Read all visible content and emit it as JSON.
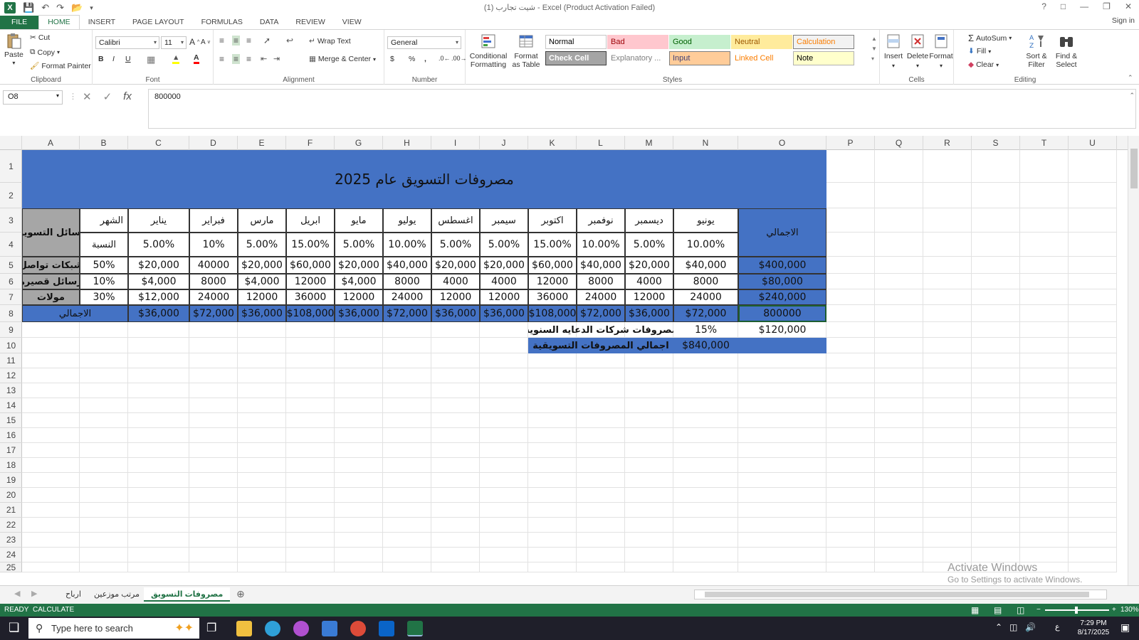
{
  "window": {
    "title": "شيت تجارب (1) - Excel (Product Activation Failed)",
    "sign_in": "Sign in"
  },
  "tabs": [
    "FILE",
    "HOME",
    "INSERT",
    "PAGE LAYOUT",
    "FORMULAS",
    "DATA",
    "REVIEW",
    "VIEW"
  ],
  "ribbon": {
    "clipboard": {
      "paste": "Paste",
      "cut": "Cut",
      "copy": "Copy",
      "format_painter": "Format Painter",
      "label": "Clipboard"
    },
    "font": {
      "name": "Calibri",
      "size": "11",
      "bold": "B",
      "italic": "I",
      "underline": "U",
      "label": "Font"
    },
    "alignment": {
      "wrap": "Wrap Text",
      "merge": "Merge & Center",
      "label": "Alignment"
    },
    "number": {
      "format": "General",
      "currency": "$",
      "percent": "%",
      "comma": ",",
      "label": "Number"
    },
    "styles": {
      "conditional": "Conditional Formatting",
      "format_table": "Format as Table",
      "cells": [
        {
          "name": "Normal",
          "bg": "#ffffff",
          "fg": "#000000",
          "border": "#c6c6c6"
        },
        {
          "name": "Bad",
          "bg": "#ffc7ce",
          "fg": "#9c0006",
          "border": "#ffc7ce"
        },
        {
          "name": "Good",
          "bg": "#c6efce",
          "fg": "#006100",
          "border": "#c6efce"
        },
        {
          "name": "Neutral",
          "bg": "#ffeb9c",
          "fg": "#9c5700",
          "border": "#ffeb9c"
        },
        {
          "name": "Calculation",
          "bg": "#f2f2f2",
          "fg": "#fa7d00",
          "border": "#7f7f7f"
        },
        {
          "name": "Check Cell",
          "bg": "#a5a5a5",
          "fg": "#ffffff",
          "border": "#3f3f3f"
        },
        {
          "name": "Explanatory ...",
          "bg": "#ffffff",
          "fg": "#7f7f7f",
          "border": "#ffffff"
        },
        {
          "name": "Input",
          "bg": "#ffcc99",
          "fg": "#3f3f76",
          "border": "#7f7f7f"
        },
        {
          "name": "Linked Cell",
          "bg": "#ffffff",
          "fg": "#fa7d00",
          "border": "#ffffff"
        },
        {
          "name": "Note",
          "bg": "#ffffcc",
          "fg": "#000000",
          "border": "#b2b2b2"
        }
      ],
      "label": "Styles"
    },
    "cells": {
      "insert": "Insert",
      "delete": "Delete",
      "format": "Format",
      "label": "Cells"
    },
    "editing": {
      "autosum": "AutoSum",
      "fill": "Fill",
      "clear": "Clear",
      "sort": "Sort & Filter",
      "find": "Find & Select",
      "label": "Editing"
    }
  },
  "formula_bar": {
    "name_box": "O8",
    "formula": "800000"
  },
  "columns": [
    "A",
    "B",
    "C",
    "D",
    "E",
    "F",
    "G",
    "H",
    "I",
    "J",
    "K",
    "L",
    "M",
    "N",
    "O",
    "P",
    "Q",
    "R",
    "S",
    "T",
    "U"
  ],
  "rows": [
    "1",
    "2",
    "3",
    "4",
    "5",
    "6",
    "7",
    "8",
    "9",
    "10",
    "11",
    "12",
    "13",
    "14",
    "15",
    "16",
    "17",
    "18",
    "19",
    "20",
    "21",
    "22",
    "23",
    "24",
    "25"
  ],
  "sheet": {
    "title": "مصروفات التسويق عام 2025",
    "marketing_means": "وسائل التسويق",
    "month_label": "الشهر",
    "ratio_label": "النسبة",
    "total_label": "الاجمالي",
    "months": [
      "يناير",
      "فبراير",
      "مارس",
      "ابريل",
      "مايو",
      "يوليو",
      "اغسطس",
      "سيمبر",
      "اكتوبر",
      "نوفمبر",
      "ديسمبر",
      "يونيو"
    ],
    "ratios": [
      "5.00%",
      "10%",
      "5.00%",
      "15.00%",
      "5.00%",
      "10.00%",
      "5.00%",
      "5.00%",
      "15.00%",
      "10.00%",
      "5.00%",
      "10.00%"
    ],
    "channels": [
      {
        "name": "شبكات تواصل",
        "share": "50%",
        "values": [
          "$20,000",
          "40000",
          "$20,000",
          "$60,000",
          "$20,000",
          "$40,000",
          "$20,000",
          "$20,000",
          "$60,000",
          "$40,000",
          "$20,000",
          "$40,000"
        ],
        "total": "$400,000"
      },
      {
        "name": "رسائل قصيرة",
        "share": "10%",
        "values": [
          "$4,000",
          "8000",
          "$4,000",
          "12000",
          "$4,000",
          "8000",
          "4000",
          "4000",
          "12000",
          "8000",
          "4000",
          "8000"
        ],
        "total": "$80,000"
      },
      {
        "name": "مولات",
        "share": "30%",
        "values": [
          "$12,000",
          "24000",
          "12000",
          "36000",
          "12000",
          "24000",
          "12000",
          "12000",
          "36000",
          "24000",
          "12000",
          "24000"
        ],
        "total": "$240,000"
      }
    ],
    "monthly_totals": [
      "$36,000",
      "$72,000",
      "$36,000",
      "$108,000",
      "$36,000",
      "$72,000",
      "$36,000",
      "$36,000",
      "$108,000",
      "$72,000",
      "$36,000",
      "$72,000"
    ],
    "grand_total": "800000",
    "agency_label": "مصروفات شركات الدعايه السنوية",
    "agency_pct": "15%",
    "agency_value": "$120,000",
    "marketing_total_label": "اجمالي المصروفات التسويقية",
    "marketing_total_value": "$840,000"
  },
  "sheet_tabs": [
    "ارباح",
    "مرتب موزعين",
    "مصروفات التسويق"
  ],
  "status": {
    "ready": "READY",
    "calculate": "CALCULATE",
    "zoom": "130%"
  },
  "watermark": {
    "line1": "Activate Windows",
    "line2": "Go to Settings to activate Windows."
  },
  "taskbar": {
    "search_placeholder": "Type here to search",
    "time": "7:29 PM",
    "date": "8/17/2025"
  }
}
